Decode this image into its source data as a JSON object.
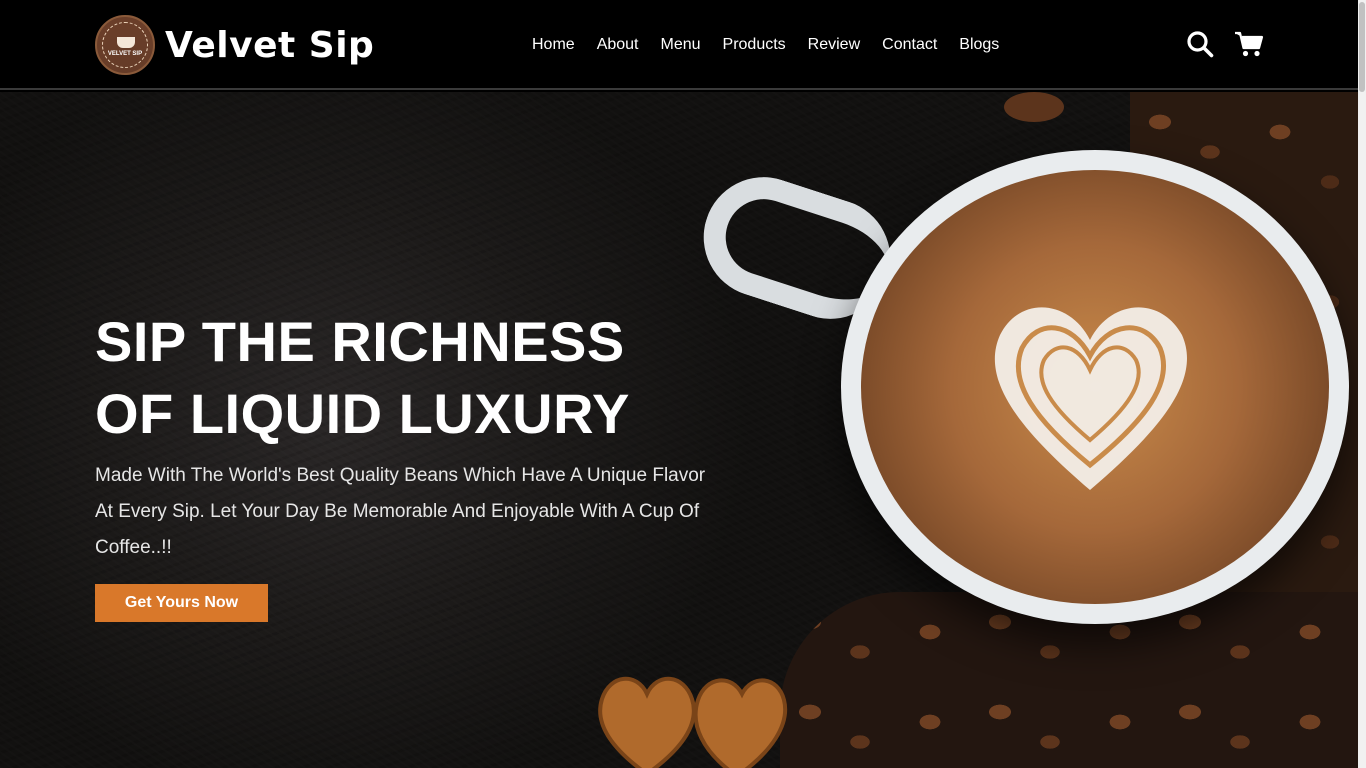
{
  "header": {
    "logo_text": "VELVET SIP",
    "brand_name": "Velvet Sip",
    "nav": [
      "Home",
      "About",
      "Menu",
      "Products",
      "Review",
      "Contact",
      "Blogs"
    ],
    "icons": [
      "search-icon",
      "cart-icon"
    ]
  },
  "hero": {
    "title_line1": "SIP THE RICHNESS",
    "title_line2": "OF LIQUID LUXURY",
    "description": "Made With The World's Best Quality Beans Which Have A Unique Flavor At Every Sip. Let Your Day Be Memorable And Enjoyable With A Cup Of Coffee..!!",
    "cta_label": "Get Yours Now"
  },
  "colors": {
    "accent": "#d9782a",
    "header_bg": "#000000",
    "hero_bg": "#1c1a19"
  }
}
